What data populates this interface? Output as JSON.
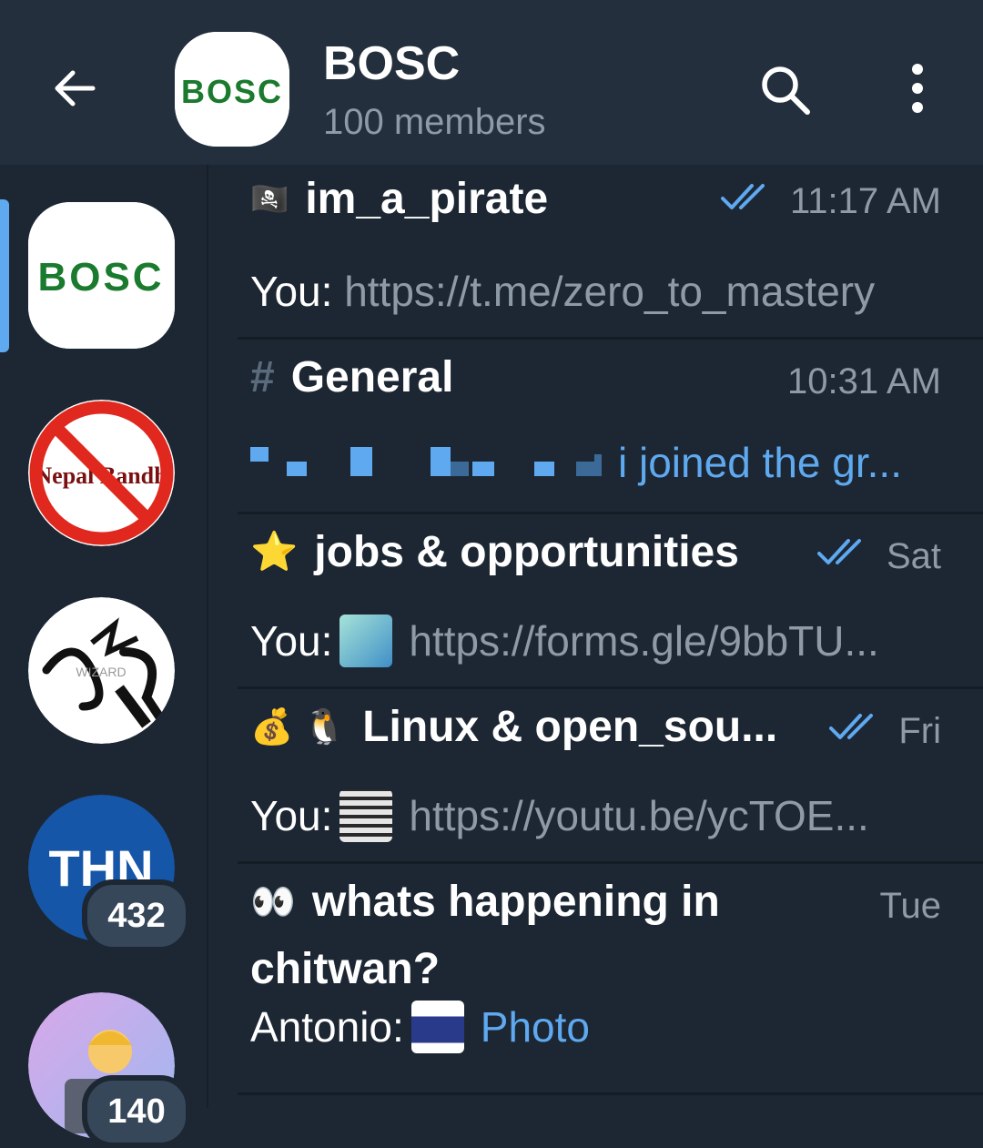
{
  "header": {
    "title": "BOSC",
    "subtitle": "100 members",
    "avatar_text": "BOSC",
    "icons": [
      "back-arrow-icon",
      "search-icon",
      "more-vertical-icon"
    ]
  },
  "sidebar": {
    "items": [
      {
        "name": "bosc-group-avatar",
        "active": true,
        "logo_text": "BOSC"
      },
      {
        "name": "nepal-bandh-avatar",
        "logo_text": "Nepal Bandh"
      },
      {
        "name": "handwritten-logo-avatar",
        "logo_text": "WIZARD"
      },
      {
        "name": "thn-avatar",
        "logo_text": "THN",
        "badge": "432"
      },
      {
        "name": "person-laptop-avatar",
        "badge": "140"
      }
    ]
  },
  "chats": [
    {
      "emoji": "🏴‍☠️",
      "name": "im_a_pirate",
      "time": "11:17 AM",
      "read": true,
      "sender": "You:",
      "text": "https://t.me/zero_to_mastery"
    },
    {
      "emoji": "#",
      "name": "General",
      "time": "10:31 AM",
      "read": false,
      "sender": "",
      "text": "i joined the gr..."
    },
    {
      "emoji": "⭐",
      "name": "jobs & opportunities",
      "time": "Sat",
      "read": true,
      "sender": "You:",
      "text": "https://forms.gle/9bbTU..."
    },
    {
      "emoji": "💰 🐧",
      "name": "Linux & open_sou...",
      "time": "Fri",
      "read": true,
      "sender": "You:",
      "text": "https://youtu.be/ycTOE..."
    },
    {
      "emoji": "👀",
      "name": "whats happening in",
      "name_line2": "chitwan?",
      "time": "Tue",
      "read": false,
      "sender": "Antonio:",
      "text": "Photo"
    }
  ],
  "colors": {
    "background": "#1d2733",
    "header": "#232f3c",
    "accent": "#5ea9f0",
    "muted_text": "#8e9aa6",
    "badge": "#37475a"
  }
}
